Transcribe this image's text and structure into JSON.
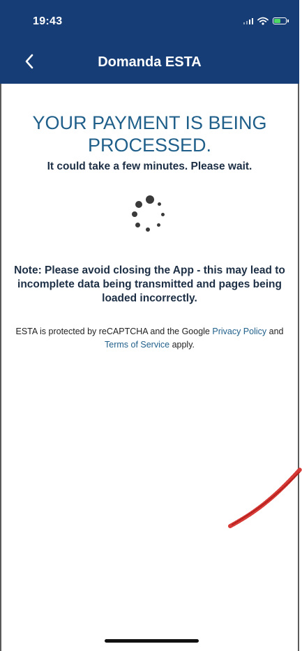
{
  "status_bar": {
    "time": "19:43"
  },
  "nav": {
    "title": "Domanda ESTA",
    "back_icon": "chevron-left-icon"
  },
  "main": {
    "headline": "YOUR PAYMENT IS BEING PROCESSED.",
    "subline": "It could take a few minutes. Please wait.",
    "note": "Note: Please avoid closing the App - this may lead to incomplete data being transmitted and pages being loaded incorrectly.",
    "legal": {
      "prefix": "ESTA is protected by reCAPTCHA and the Google ",
      "privacy_link": "Privacy Policy",
      "middle": " and ",
      "terms_link": "Terms of Service",
      "suffix": " apply."
    }
  },
  "colors": {
    "header_bg": "#163d75",
    "headline": "#1f5f8a",
    "link": "#1f5f8a",
    "body_text": "#1d2f45"
  }
}
